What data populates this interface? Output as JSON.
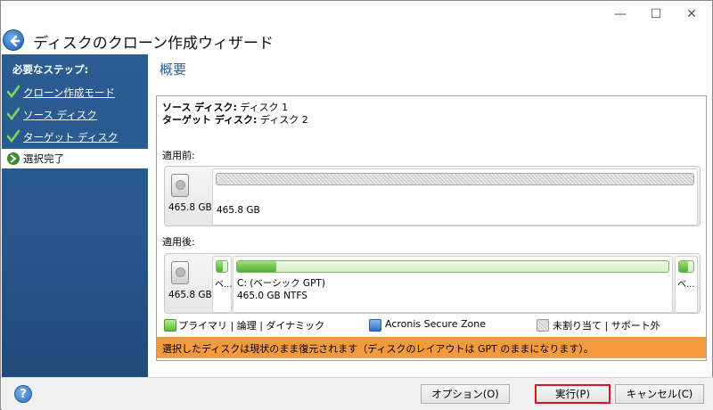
{
  "window": {
    "title": "ディスクのクローン作成ウィザード",
    "controls": {
      "minimize": "—",
      "maximize": "☐",
      "close": "✕"
    }
  },
  "sidebar": {
    "heading": "必要なステップ:",
    "items": [
      {
        "label": "クローン作成モード",
        "status": "done"
      },
      {
        "label": "ソース ディスク",
        "status": "done"
      },
      {
        "label": "ターゲット ディスク",
        "status": "done"
      },
      {
        "label": "選択完了",
        "status": "current"
      }
    ]
  },
  "main": {
    "title": "概要",
    "source_label": "ソース ディスク:",
    "source_value": "ディスク 1",
    "target_label": "ターゲット ディスク:",
    "target_value": "ディスク 2",
    "before": {
      "label": "適用前:",
      "disk_size": "465.8 GB",
      "partition_size": "465.8 GB"
    },
    "after": {
      "label": "適用後:",
      "disk_size": "465.8 GB",
      "left_part_label": "ベ...",
      "right_part_label": "ベ...",
      "partition_name": "C: (ベーシック GPT)",
      "partition_details": "465.0 GB  NTFS",
      "used_fraction": 0.09
    },
    "legend": {
      "primary": "プライマリ",
      "logical": "論理",
      "dynamic": "ダイナミック",
      "secure_zone": "Acronis Secure Zone",
      "unallocated": "未割り当て",
      "unsupported": "サポート外"
    },
    "notice": "選択したディスクは現状のまま復元されます（ディスクのレイアウトは GPT のままになります）。"
  },
  "buttons": {
    "help": "?",
    "options": "オプション(O)",
    "execute": "実行(P)",
    "cancel": "キャンセル(C)"
  },
  "colors": {
    "sidebar": "#27578c",
    "title_accent": "#2d5f9a",
    "notice": "#f49a3c",
    "primary_partition": "#4fae2d",
    "execute_highlight": "#e0141e"
  },
  "icons": {
    "back": "back-arrow-icon",
    "check": "green-checkmark-icon",
    "current_step": "green-arrow-icon",
    "disk": "disk-drive-icon",
    "help": "help-icon"
  }
}
